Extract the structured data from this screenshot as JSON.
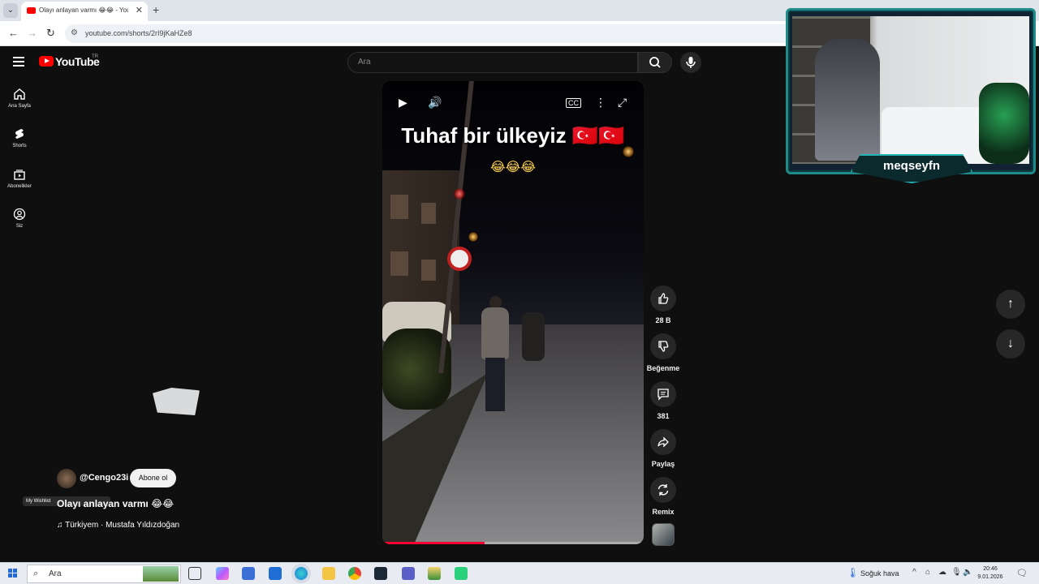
{
  "browser": {
    "tab_title": "Olayı anlayan varmı 😂😂 - YouTube",
    "url": "youtube.com/shorts/2rI9jKaHZe8"
  },
  "header": {
    "brand": "YouTube",
    "country": "TR",
    "search_placeholder": "Ara"
  },
  "guide": {
    "items": [
      {
        "label": "Ana Sayfa",
        "icon": "home-icon"
      },
      {
        "label": "Shorts",
        "icon": "shorts-icon"
      },
      {
        "label": "Abonelikler",
        "icon": "subscriptions-icon"
      },
      {
        "label": "Siz",
        "icon": "account-icon"
      }
    ]
  },
  "player": {
    "overlay_title": "Tuhaf bir ülkeyiz 🇹🇷🇹🇷",
    "overlay_emoji": "😂😂😂",
    "progress": 0.39
  },
  "actions": {
    "like_count": "28 B",
    "dislike_label": "Beğenme",
    "comment_count": "381",
    "share_label": "Paylaş",
    "remix_label": "Remix"
  },
  "short": {
    "channel": "@Cengo23i",
    "subscribe_label": "Abone ol",
    "title": "Olayı anlayan varmı 😂😂",
    "audio": "♫ Türkiyem · Mustafa Yıldızdoğan",
    "wishlist_text": "My Wishlist"
  },
  "webcam": {
    "streamer_name": "meqseyfn"
  },
  "taskbar": {
    "search_label": "Ara",
    "weather": "Soğuk hava",
    "time": "20:46",
    "date": "9.01.2026"
  },
  "colors": {
    "accent_red": "#ff0000",
    "progress_red": "#ff0033",
    "cam_border": "#1f8a8a"
  }
}
